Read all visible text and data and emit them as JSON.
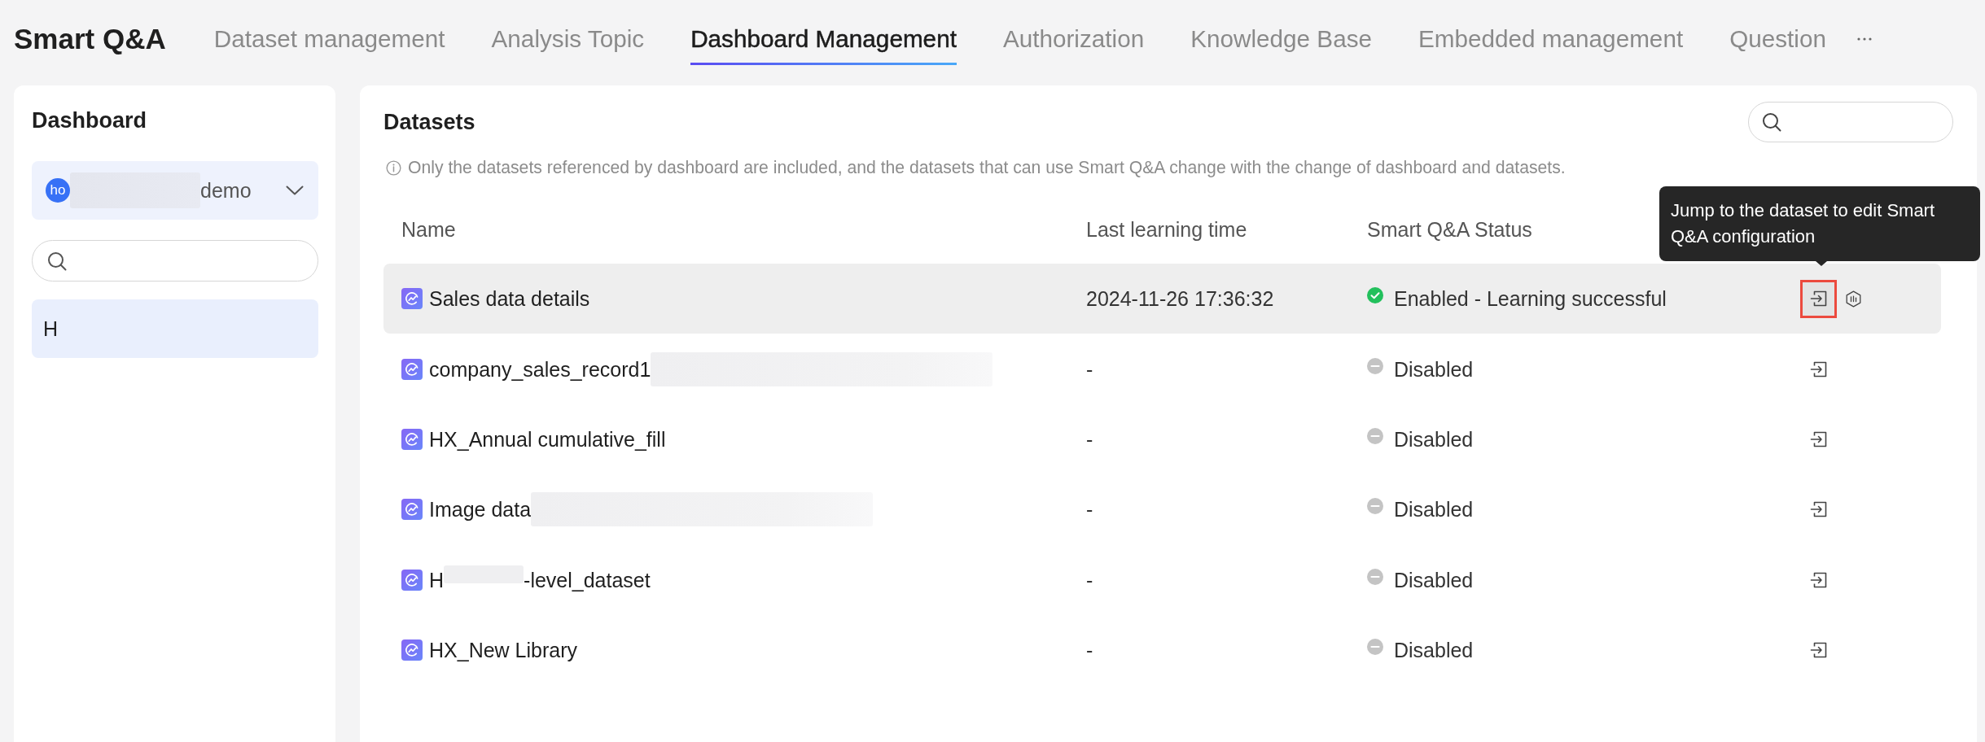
{
  "header": {
    "title": "Smart Q&A",
    "tabs": [
      {
        "label": "Dataset management",
        "selected": false
      },
      {
        "label": "Analysis Topic",
        "selected": false
      },
      {
        "label": "Dashboard Management",
        "selected": true
      },
      {
        "label": "Authorization",
        "selected": false
      },
      {
        "label": "Knowledge Base",
        "selected": false
      },
      {
        "label": "Embedded management",
        "selected": false
      },
      {
        "label": "Question",
        "selected": false
      }
    ]
  },
  "sidebar": {
    "title": "Dashboard",
    "selector": {
      "avatar": "ho",
      "parts": [
        {
          "kind": "redaction"
        },
        {
          "kind": "text",
          "text": "demo"
        }
      ]
    },
    "items": [
      {
        "label": "H",
        "selected": true
      }
    ]
  },
  "datasets": {
    "title": "Datasets",
    "note": "Only the datasets referenced by dashboard are included, and the datasets that can use Smart Q&A change with the change of dashboard and datasets.",
    "columns": [
      "Name",
      "Last learning time",
      "Smart Q&A Status"
    ],
    "rows": [
      {
        "parts": [
          {
            "kind": "text",
            "text": "Sales data details"
          }
        ],
        "last_learning_time": "2024-11-26 17:36:32",
        "status": {
          "kind": "enabled",
          "text": "Enabled - Learning successful"
        },
        "hovered": true,
        "actions": [
          {
            "kind": "jump",
            "highlighted": true
          },
          {
            "kind": "analyze",
            "highlighted": false
          }
        ]
      },
      {
        "parts": [
          {
            "kind": "text",
            "text": "company_sales_record1"
          },
          {
            "kind": "redaction"
          }
        ],
        "last_learning_time": "-",
        "status": {
          "kind": "disabled",
          "text": "Disabled"
        },
        "hovered": false,
        "actions": [
          {
            "kind": "jump",
            "highlighted": false
          }
        ]
      },
      {
        "parts": [
          {
            "kind": "text",
            "text": "HX_Annual cumulative_fill"
          }
        ],
        "last_learning_time": "-",
        "status": {
          "kind": "disabled",
          "text": "Disabled"
        },
        "hovered": false,
        "actions": [
          {
            "kind": "jump",
            "highlighted": false
          }
        ]
      },
      {
        "parts": [
          {
            "kind": "text",
            "text": "Image data"
          },
          {
            "kind": "redaction"
          }
        ],
        "last_learning_time": "-",
        "status": {
          "kind": "disabled",
          "text": "Disabled"
        },
        "hovered": false,
        "actions": [
          {
            "kind": "jump",
            "highlighted": false
          }
        ]
      },
      {
        "parts": [
          {
            "kind": "text",
            "text": "H"
          },
          {
            "kind": "redaction"
          },
          {
            "kind": "text",
            "text": "-level_dataset"
          }
        ],
        "last_learning_time": "-",
        "status": {
          "kind": "disabled",
          "text": "Disabled"
        },
        "hovered": false,
        "actions": [
          {
            "kind": "jump",
            "highlighted": false
          }
        ]
      },
      {
        "parts": [
          {
            "kind": "text",
            "text": "HX_New Library"
          }
        ],
        "last_learning_time": "-",
        "status": {
          "kind": "disabled",
          "text": "Disabled"
        },
        "hovered": false,
        "actions": [
          {
            "kind": "jump",
            "highlighted": false
          }
        ]
      }
    ]
  },
  "tooltip": {
    "text": "Jump to the dataset to edit Smart Q&A configuration"
  }
}
